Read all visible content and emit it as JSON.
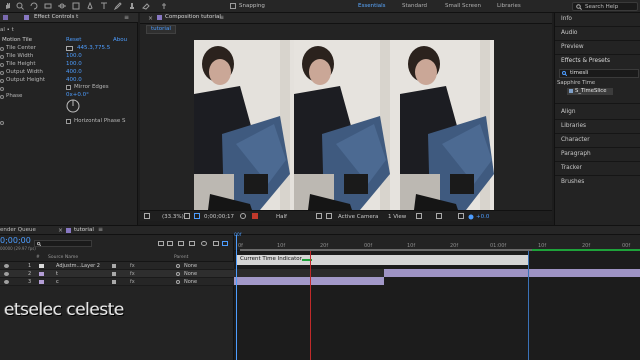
{
  "toolbar": {
    "snapping_label": "Snapping",
    "workspaces": [
      "Essentials",
      "Standard",
      "Small Screen",
      "Libraries"
    ],
    "active_workspace": "Essentials",
    "search_placeholder": "Search Help"
  },
  "effect_controls": {
    "tab_label": "Effect Controls t",
    "layer_label": "al • t",
    "effect_name": "Motion Tile",
    "reset_label": "Reset",
    "about_label": "Abou",
    "properties": [
      {
        "name": "Tile Center",
        "value": "445.3,775.5"
      },
      {
        "name": "Tile Width",
        "value": "100.0"
      },
      {
        "name": "Tile Height",
        "value": "100.0"
      },
      {
        "name": "Output Width",
        "value": "400.0"
      },
      {
        "name": "Output Height",
        "value": "400.0"
      },
      {
        "name": "Mirror Edges",
        "value": "Mirror Edges"
      },
      {
        "name": "Phase",
        "value": "0x+0.0°"
      },
      {
        "name": "Horizontal Phase",
        "value": "Horizontal Phase S"
      }
    ]
  },
  "composition": {
    "tab_label": "Composition tutorial",
    "subtab_label": "tutorial",
    "footer": {
      "zoom": "(33.3%)",
      "timecode": "0;00;00;17",
      "resolution": "Half",
      "camera": "Active Camera",
      "view": "1 View",
      "exposure": "+0.0"
    }
  },
  "right_panel": {
    "items": [
      "Info",
      "Audio",
      "Preview",
      "Effects & Presets"
    ],
    "search_value": "timesli",
    "group_name": "Sapphire Time",
    "effect_item": "S_TimeSlice",
    "lower_items": [
      "Align",
      "Libraries",
      "Character",
      "Paragraph",
      "Tracker",
      "Brushes"
    ]
  },
  "timeline": {
    "render_queue_tab": "ender Queue",
    "comp_tab": "tutorial",
    "current_time": "0;00;00",
    "fps_label": "00000 (29.97 fps)",
    "column_headers": {
      "num": "#",
      "source_name": "Source Name",
      "parent": "Parent"
    },
    "layers": [
      {
        "num": "1",
        "name": "Adjustm...Layer 2",
        "parent": "None",
        "color": "#d9d9d9"
      },
      {
        "num": "2",
        "name": "t",
        "parent": "None",
        "color": "#b49ed6"
      },
      {
        "num": "3",
        "name": "c",
        "parent": "None",
        "color": "#b49ed6"
      }
    ],
    "ruler_ticks": [
      "0f",
      "10f",
      "20f",
      "00f",
      "10f",
      "20f",
      "01:00f",
      "10f",
      "20f",
      "00f"
    ],
    "indicator_label": "Current Time Indicator",
    "playhead_label": "00f"
  },
  "watermark": "etselec celeste",
  "colors": {
    "accent_blue": "#4d9dff",
    "layer_purple": "#9e93c4",
    "playhead_red": "#c02a2a"
  }
}
